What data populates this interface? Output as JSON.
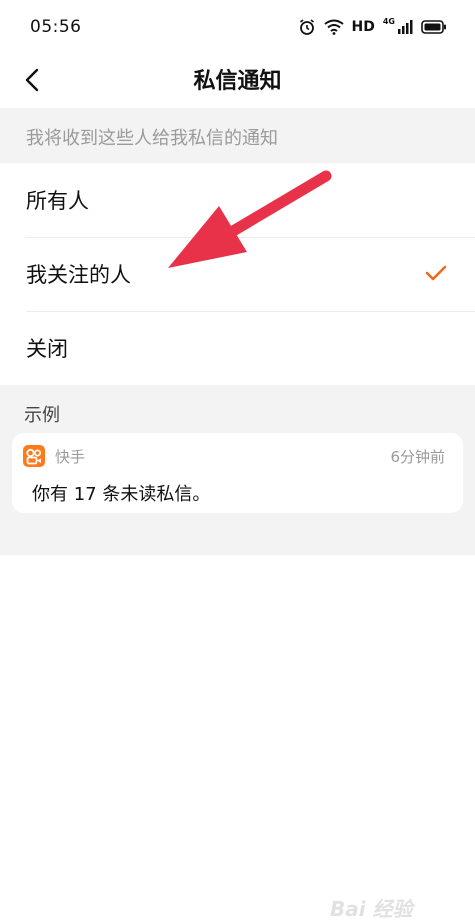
{
  "status_bar": {
    "time": "05:56",
    "hd_label": "HD",
    "network_label": "4G",
    "icons": [
      "alarm-icon",
      "wifi-icon",
      "signal-icon",
      "battery-icon"
    ]
  },
  "nav": {
    "title": "私信通知",
    "back_icon": "chevron-left-icon"
  },
  "section_hint": "我将收到这些人给我私信的通知",
  "options": [
    {
      "label": "所有人",
      "selected": false
    },
    {
      "label": "我关注的人",
      "selected": true
    },
    {
      "label": "关闭",
      "selected": false
    }
  ],
  "example": {
    "label": "示例",
    "app_name": "快手",
    "time": "6分钟前",
    "body": "你有 17 条未读私信。"
  },
  "watermark": "Bai 经验",
  "colors": {
    "accent": "#f06a1b",
    "arrow": "#e8324a",
    "hint_bg": "#f3f3f3",
    "app_icon": "#ff7a1a"
  }
}
